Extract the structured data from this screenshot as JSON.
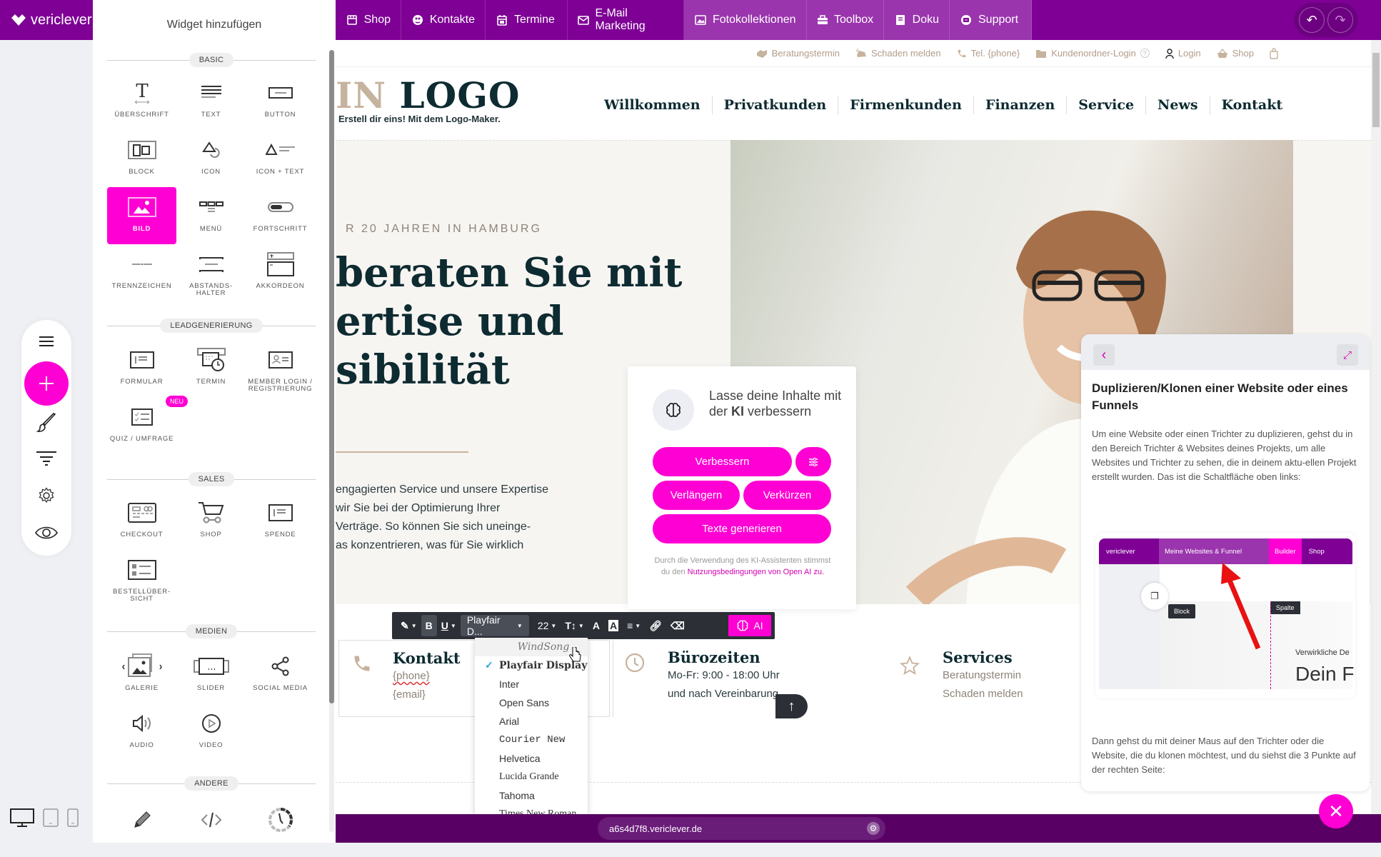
{
  "app": {
    "brand": "vericlever",
    "undo_icon": "undo-icon",
    "redo_icon": "redo-icon"
  },
  "topnav": [
    {
      "label": "Shop",
      "icon": "store-icon"
    },
    {
      "label": "Kontakte",
      "icon": "contacts-icon"
    },
    {
      "label": "Termine",
      "icon": "calendar-icon"
    },
    {
      "label": "E-Mail Marketing",
      "icon": "mail-icon"
    },
    {
      "label": "Fotokollektionen",
      "icon": "photo-icon",
      "active": true
    },
    {
      "label": "Toolbox",
      "icon": "toolbox-icon",
      "active": true
    },
    {
      "label": "Doku",
      "icon": "book-icon",
      "active": true
    },
    {
      "label": "Support",
      "icon": "support-icon",
      "active": true
    }
  ],
  "widget_panel": {
    "title": "Widget hinzufügen",
    "sections": [
      {
        "label": "BASIC",
        "items": [
          {
            "label": "ÜBERSCHRIFT",
            "icon": "heading-icon"
          },
          {
            "label": "TEXT",
            "icon": "text-icon"
          },
          {
            "label": "BUTTON",
            "icon": "button-icon"
          },
          {
            "label": "BLOCK",
            "icon": "block-icon"
          },
          {
            "label": "ICON",
            "icon": "shapes-icon"
          },
          {
            "label": "ICON + TEXT",
            "icon": "icon-text-icon"
          },
          {
            "label": "BILD",
            "icon": "image-icon",
            "selected": true
          },
          {
            "label": "MENÜ",
            "icon": "menu-widget-icon"
          },
          {
            "label": "FORTSCHRITT",
            "icon": "progress-icon"
          },
          {
            "label": "TRENNZEICHEN",
            "icon": "divider-icon"
          },
          {
            "label": "ABSTANDS-\nHALTER",
            "icon": "spacer-icon"
          },
          {
            "label": "AKKORDEON",
            "icon": "accordion-icon"
          }
        ]
      },
      {
        "label": "LEADGENERIERUNG",
        "items": [
          {
            "label": "FORMULAR",
            "icon": "form-icon"
          },
          {
            "label": "TERMIN",
            "icon": "appointment-icon"
          },
          {
            "label": "MEMBER LOGIN /\nREGISTRIERUNG",
            "icon": "member-login-icon"
          },
          {
            "label": "QUIZ / UMFRAGE",
            "icon": "quiz-icon",
            "badge": "NEU"
          }
        ]
      },
      {
        "label": "SALES",
        "items": [
          {
            "label": "CHECKOUT",
            "icon": "checkout-icon"
          },
          {
            "label": "SHOP",
            "icon": "cart-icon"
          },
          {
            "label": "SPENDE",
            "icon": "donation-icon"
          },
          {
            "label": "BESTELLÜBER-\nSICHT",
            "icon": "order-overview-icon"
          }
        ]
      },
      {
        "label": "MEDIEN",
        "items": [
          {
            "label": "GALERIE",
            "icon": "gallery-icon"
          },
          {
            "label": "SLIDER",
            "icon": "slider-icon"
          },
          {
            "label": "SOCIAL MEDIA",
            "icon": "share-icon"
          },
          {
            "label": "AUDIO",
            "icon": "audio-icon"
          },
          {
            "label": "VIDEO",
            "icon": "video-icon"
          }
        ]
      },
      {
        "label": "ANDERE",
        "items": [
          {
            "label": "",
            "icon": "pencil-icon"
          },
          {
            "label": "",
            "icon": "code-icon"
          },
          {
            "label": "",
            "icon": "countdown-icon"
          }
        ]
      }
    ]
  },
  "rail": [
    "menu-icon",
    "add-icon",
    "brush-icon",
    "filter-icon",
    "gear-icon",
    "eye-icon"
  ],
  "devices": [
    "desktop-icon",
    "tablet-icon",
    "mobile-icon"
  ],
  "site": {
    "utilbar": [
      {
        "label": "Beratungstermin",
        "icon": "handshake-icon"
      },
      {
        "label": "Schaden melden",
        "icon": "car-crash-icon"
      },
      {
        "label": "Tel. {phone}",
        "icon": "phone-icon"
      },
      {
        "label": "Kundenordner-Login",
        "icon": "folder-icon",
        "extra": "?"
      },
      {
        "label": "Login",
        "icon": "user-icon"
      },
      {
        "label": "Shop",
        "icon": "basket-icon"
      },
      {
        "label": "",
        "icon": "bag-icon"
      }
    ],
    "logo_text_prefix": "IN ",
    "logo_text": "LOGO",
    "logo_tagline": "Erstell dir eins! Mit dem Logo-Maker.",
    "mainnav": [
      "Willkommen",
      "Privatkunden",
      "Firmenkunden",
      "Finanzen",
      "Service",
      "News",
      "Kontakt"
    ],
    "hero": {
      "kicker": "R 20 JAHREN IN HAMBURG",
      "headline": "beraten Sie mit\nertise und\nsibilität",
      "text": "engagierten Service und unsere Expertise\nwir Sie bei der Optimierung Ihrer\nVerträge. So können Sie sich uneinge-\nas konzentrieren, was für Sie wirklich"
    },
    "info": {
      "kontakt": {
        "title": "Kontakt",
        "lines": [
          "{phone}",
          "{email}"
        ]
      },
      "buero": {
        "title": "Bürozeiten",
        "lines": [
          "Mo-Fr: 9:00 - 18:00 Uhr",
          "und nach Vereinbarung"
        ]
      },
      "services": {
        "title": "Services",
        "lines": [
          "Beratungstermin",
          "Schaden melden"
        ]
      }
    }
  },
  "ki_panel": {
    "heading_pre": "Lasse deine Inhalte mit der ",
    "heading_bold": "KI",
    "heading_post": " verbessern",
    "buttons": {
      "improve": "Verbessern",
      "extend": "Verlängern",
      "shorten": "Verkürzen",
      "generate": "Texte generieren"
    },
    "note_pre": "Durch die Verwendung des KI-Assistenten stimmst du den ",
    "note_link": "Nutzungsbedingungen von Open AI zu."
  },
  "toolbar": {
    "font": "Playfair D...",
    "size": "22",
    "ai_label": "AI"
  },
  "font_dropdown": {
    "options": [
      "WindSong",
      "Playfair Display",
      "Inter",
      "Open Sans",
      "Arial",
      "Courier New",
      "Helvetica",
      "Lucida Grande",
      "Tahoma",
      "Times New Roman"
    ],
    "selected": "Playfair Display",
    "hovered": "WindSong"
  },
  "help_panel": {
    "title": "Duplizieren/Klonen einer Website oder eines Funnels",
    "p1": "Um eine Website oder einen Trichter zu duplizieren, gehst du in den Bereich Trichter & Websites deines Projekts, um alle Websites und Trichter zu sehen, die in deinem aktu-ellen Projekt erstellt wurden. Das ist die Schaltfläche oben links:",
    "p2": "Dann gehst du mit deiner Maus auf den Trichter oder die Website, die du klonen möchtest, und du siehst die 3 Punkte auf der rechten Seite:",
    "screenshot": {
      "brand": "vericlever",
      "tab": "Meine Websites & Funnel",
      "builder": "Builder",
      "shop": "Shop",
      "block": "Block",
      "spalte": "Spalte",
      "line1": "Verwirkliche De",
      "line2": "Dein F"
    }
  },
  "bottombar": {
    "url": "a6s4d7f8.vericlever.de"
  },
  "colors": {
    "brand_purple": "#7e0095",
    "accent_magenta": "#ff00d4",
    "dark_teal": "#0d2b31",
    "tan": "#c6b39d"
  }
}
